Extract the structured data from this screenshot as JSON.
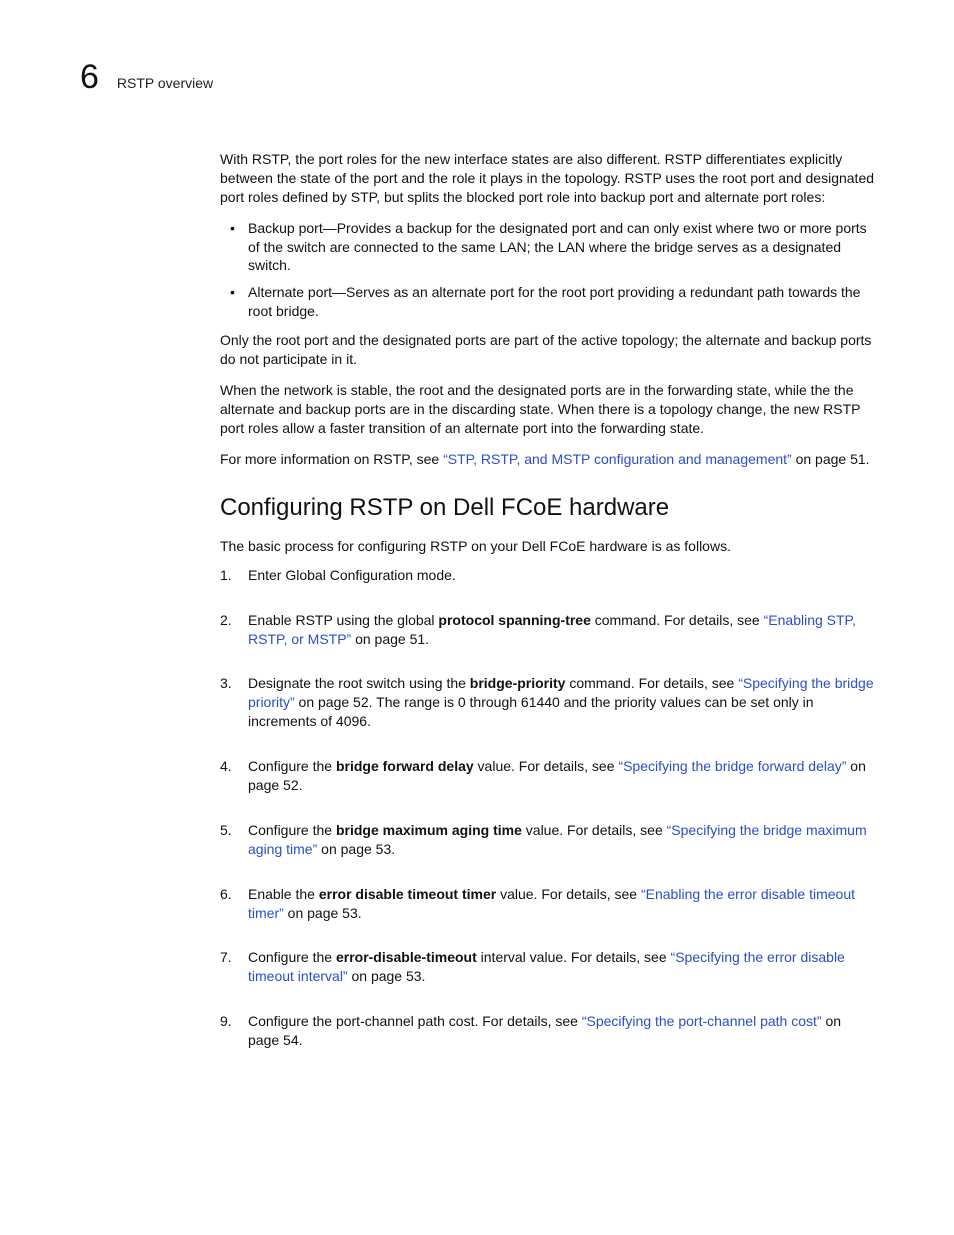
{
  "runhead": {
    "chapter_number": "6",
    "chapter_title": "RSTP overview"
  },
  "intro_para": "With RSTP, the port roles for the new interface states are also different. RSTP differentiates explicitly between the state of the port and the role it plays in the topology. RSTP uses the root port and designated port roles defined by STP, but splits the blocked port role into backup port and alternate port roles:",
  "bullets": [
    "Backup port—Provides a backup for the designated port and can only exist where two or more ports of the switch are connected to the same LAN; the LAN where the bridge serves as a designated switch.",
    "Alternate port—Serves as an alternate port for the root port providing a redundant path towards the root bridge."
  ],
  "after_bullets_1": "Only the root port and the designated ports are part of the active topology; the alternate and backup ports do not participate in it.",
  "after_bullets_2": "When the network is stable, the root and the designated ports are in the forwarding state, while the the alternate and backup ports are in the discarding state. When there is a topology change, the new RSTP port roles allow a faster transition of an alternate port into the forwarding state.",
  "more_info_pre": "For more information on RSTP, see ",
  "more_info_link": "“STP, RSTP, and MSTP configuration and management”",
  "more_info_post": " on page 51.",
  "section_heading": "Configuring RSTP on Dell FCoE hardware",
  "section_intro": "The basic process for configuring RSTP on your Dell FCoE hardware is as follows.",
  "steps": {
    "s1": {
      "marker": "1.",
      "text": "Enter Global Configuration mode."
    },
    "s2": {
      "marker": "2.",
      "pre": "Enable RSTP using the global ",
      "bold": "protocol spanning-tree",
      "mid": " command. For details, see ",
      "link": "“Enabling STP, RSTP, or MSTP”",
      "post": " on page 51."
    },
    "s3": {
      "marker": "3.",
      "pre": "Designate the root switch using the ",
      "bold": "bridge-priority",
      "mid": " command. For details, see ",
      "link": "“Specifying the bridge priority”",
      "post": " on page 52. The range is 0 through 61440 and the priority values can be set only in increments of 4096."
    },
    "s4": {
      "marker": "4.",
      "pre": "Configure the ",
      "bold": "bridge forward delay",
      "mid": " value. For details, see ",
      "link": "“Specifying the bridge forward delay”",
      "post": " on page 52."
    },
    "s5": {
      "marker": "5.",
      "pre": "Configure the ",
      "bold": "bridge maximum aging time",
      "mid": " value. For details, see ",
      "link": "“Specifying the bridge maximum aging time”",
      "post": " on page 53."
    },
    "s6": {
      "marker": "6.",
      "pre": "Enable the ",
      "bold": "error disable timeout timer",
      "mid": " value. For details, see ",
      "link": "“Enabling the error disable timeout timer”",
      "post": " on page 53."
    },
    "s7": {
      "marker": "7.",
      "pre": "Configure the ",
      "bold": "error-disable-timeout",
      "mid": " interval value. For details, see ",
      "link": "“Specifying the error disable timeout interval”",
      "post": " on page 53."
    },
    "s9": {
      "marker": "9.",
      "pre": "Configure the port-channel path cost. For details, see ",
      "link": "“Specifying the port-channel path cost”",
      "post": " on page 54."
    }
  }
}
